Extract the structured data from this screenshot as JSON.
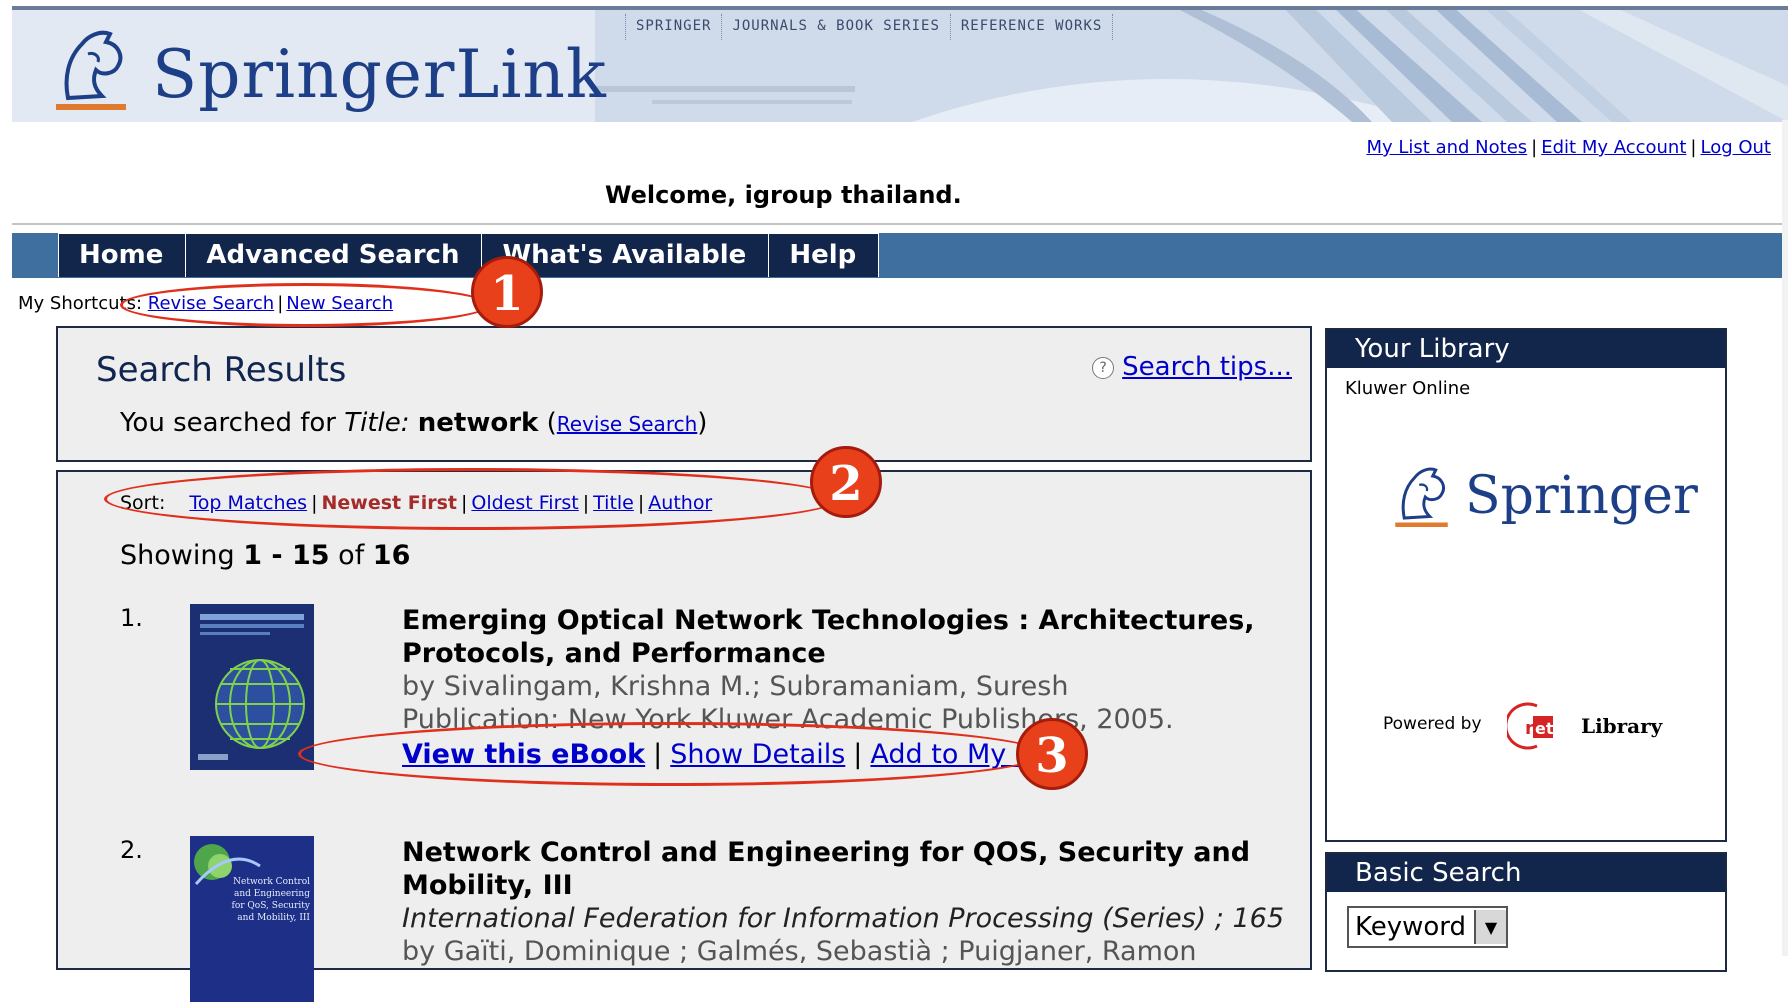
{
  "banner": {
    "brand": "SpringerLink",
    "top_nav": [
      "SPRINGER",
      "JOURNALS & BOOK SERIES",
      "REFERENCE WORKS"
    ]
  },
  "account": {
    "links": [
      "My List and Notes",
      "Edit My Account",
      "Log Out"
    ],
    "welcome": "Welcome, igroup thailand."
  },
  "tabs": [
    "Home",
    "Advanced Search",
    "What's Available",
    "Help"
  ],
  "shortcuts": {
    "label": "My Shortcuts:",
    "links": [
      "Revise Search",
      "New Search"
    ]
  },
  "callouts": [
    "1",
    "2",
    "3"
  ],
  "search": {
    "title": "Search Results",
    "tips": "Search tips...",
    "you_searched_for": "You searched for",
    "field": "Title:",
    "term": "network",
    "revise_link": "Revise Search"
  },
  "sort": {
    "label": "Sort:",
    "options": [
      "Top Matches",
      "Newest First",
      "Oldest First",
      "Title",
      "Author"
    ],
    "active": "Newest First"
  },
  "showing": {
    "prefix": "Showing",
    "range": "1 - 15",
    "of": "of",
    "total": "16"
  },
  "results": [
    {
      "num": "1.",
      "title": "Emerging Optical Network Technologies : Architectures, Protocols, and Performance",
      "authors": "by Sivalingam, Krishna M.; Subramaniam, Suresh",
      "publication": "Publication: New York Kluwer Academic Publishers, 2005.",
      "links": [
        "View this eBook",
        "Show Details",
        "Add to My List"
      ]
    },
    {
      "num": "2.",
      "title": "Network Control and Engineering for QOS, Security and Mobility, III",
      "series": "International Federation for Information Processing (Series) ; 165",
      "authors": "by Gaïti, Dominique ; Galmés, Sebastià ; Puigjaner, Ramon",
      "cover_text": "Network Control and Engineering for QoS, Security and Mobility, III"
    }
  ],
  "library": {
    "heading": "Your Library",
    "name": "Kluwer Online",
    "publisher": "Springer",
    "powered_by": "Powered by",
    "provider": "Library"
  },
  "basic_search": {
    "heading": "Basic Search",
    "field": "Keyword"
  },
  "colors": {
    "navy": "#12254a",
    "tabbar": "#3f6f9e",
    "callout": "#e8401a",
    "link": "#0000cc",
    "active_sort": "#a52a2a"
  }
}
